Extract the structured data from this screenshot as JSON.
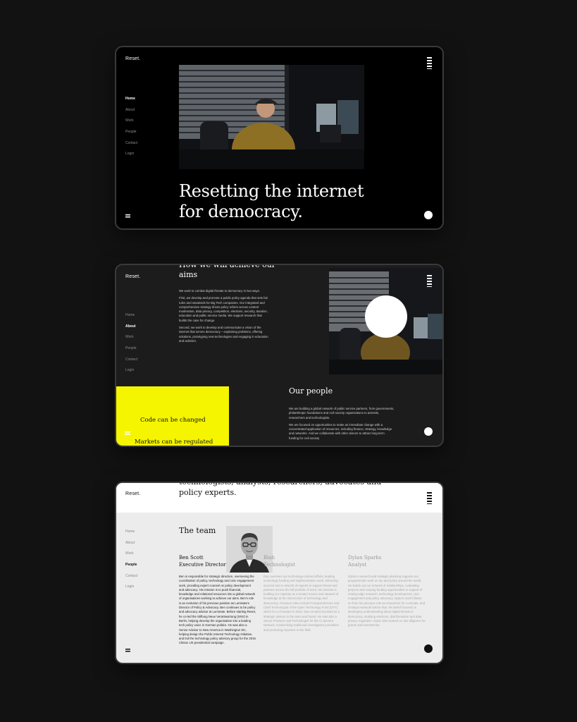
{
  "brand": "Reset.",
  "nav": [
    "Home",
    "About",
    "Work",
    "People",
    "Contact",
    "Login"
  ],
  "hero": {
    "headline": "Resetting the internet for democracy."
  },
  "aims": {
    "title": "How we will achieve our aims",
    "paragraphs": [
      "We work to combat digital threats to democracy in two ways.",
      "First, we develop and promote a public policy agenda that sets fair rules and standards for Big Tech companies. Our integrated and comprehensive strategy drives policy reform across content moderation, data privacy, competition, elections, security, taxation, education and public service media. We support research that builds the case for change.",
      "Second, we work to develop and communicate a vision of the internet that serves democracy – explaining problems, offering solutions, prototyping new technologies and engaging in education and activism."
    ]
  },
  "yellow_block": {
    "line1": "Code can be changed",
    "line2": "Markets can be regulated"
  },
  "people": {
    "title": "Our people",
    "paragraphs": [
      "We are building a global network of public service partners, from governments, philanthropic foundations and civil society organisations to activists, researchers and technologists.",
      "We are focused on opportunities to make an immediate change with a concentrated application of resources, including finance, strategy, knowledge and networks. And we collaborate with other donors to attract long-term funding for civil society"
    ]
  },
  "team_page": {
    "intro": "technologists, analysts, researchers, advocates and policy experts.",
    "team_title": "The team",
    "members": [
      {
        "name": "Ben Scott",
        "title": "Executive Director",
        "bio": "Ben is responsible for strategic direction, overseeing the coordination of policy, technology and civic engagement work, providing expert counsel on policy development and advocacy. His mission is to push financial, knowledge and relational resources into a global network of organisations working to achieve our aims. Ben's role is an evolution of his previous position as Luminate's Director of Policy & Advocacy. Ben continues to be policy and advocacy advisor at Luminate. Before starting Reset, he co-led the Stiftung Neue Verantwortung (SNV) in Berlin, helping develop the organisation into a leading tech policy voice in German politics. He was also a Senior Advisor to New America in Washington DC, helping design the Public Interest Technology Initiative, and led the technology policy advisory group for the 2016 Clinton US presidential campaign."
      },
      {
        "name": "Blah",
        "title": "Technologist",
        "bio": "Dan oversees our technology-centred efforts, leading technology funding and implementation work, delivering sourced and a network of experts to support Reset and partners across the full portfolio of work. His mission is building our capacity as a trusted source and steward of knowledge at the intersection of technology and democracy. Previous roles include Principal Director and Chief Technologist of the Open Technology Fund (OTF), which he co-founded in 2012. Dan remains involved as a strategic advisor to the team and board. He was also a Senior Producer and Technologist for the Al Jazeera Network, modernising traditional investigative journalism and protecting reporters in the field."
      },
      {
        "name": "Dylan Sparks",
        "title": "Analyst",
        "bio": "Dylan's research and strategic planning supports our programmatic work on tax and policy around the world. He builds out our network of relationships, evaluating projects and scoping funding opportunities in support of cutting-edge research, technology development, civic engagement and policy advocacy. Dylan's work follows on from his previous role as researcher for Luminate, and Omidyar Network before that. His belief focused on developing understanding about digital threats to democracy, studying elections, disinformation and data privacy regulation. Dylan also worked on due diligence for grants and investments."
      }
    ]
  }
}
